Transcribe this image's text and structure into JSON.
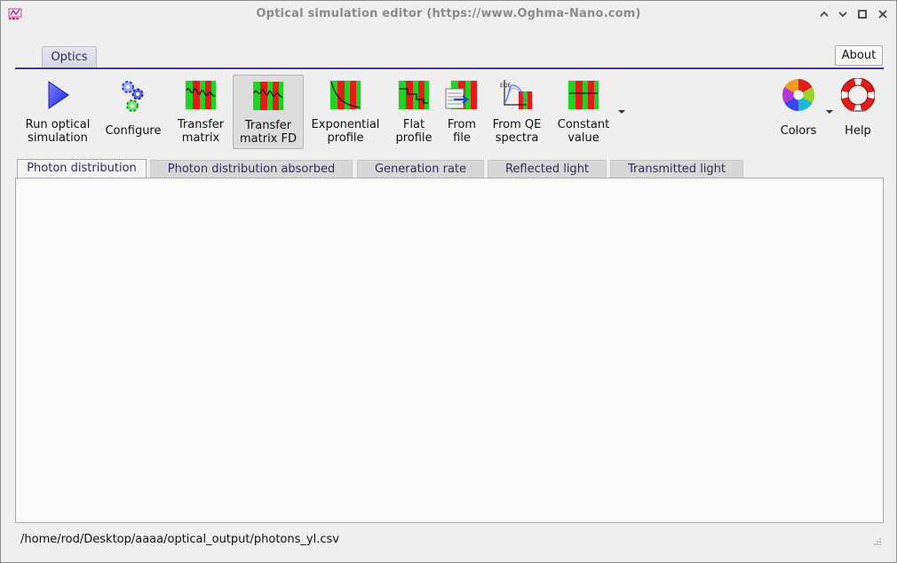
{
  "window": {
    "title": "Optical simulation editor (https://www.Oghma-Nano.com)"
  },
  "ribbon": {
    "tab_label": "Optics",
    "about_label": "About"
  },
  "toolbar": {
    "run": "Run optical\nsimulation",
    "configure": "Configure",
    "transfer_matrix": "Transfer\nmatrix",
    "transfer_matrix_fd": "Transfer\nmatrix FD",
    "exponential": "Exponential\nprofile",
    "flat": "Flat\nprofile",
    "from_file": "From\nfile",
    "from_qe": "From QE\nspectra",
    "constant": "Constant\nvalue",
    "colors": "Colors",
    "help": "Help"
  },
  "subtabs": [
    "Photon distribution",
    "Photon distribution absorbed",
    "Generation rate",
    "Reflected light",
    "Transmitted light"
  ],
  "status": {
    "path": "/home/rod/Desktop/aaaa/optical_output/photons_yl.csv"
  },
  "colors": {
    "accent": "#3b3c8c",
    "play": "#3a3ee8",
    "red": "#e21b1b",
    "green": "#21d321"
  }
}
